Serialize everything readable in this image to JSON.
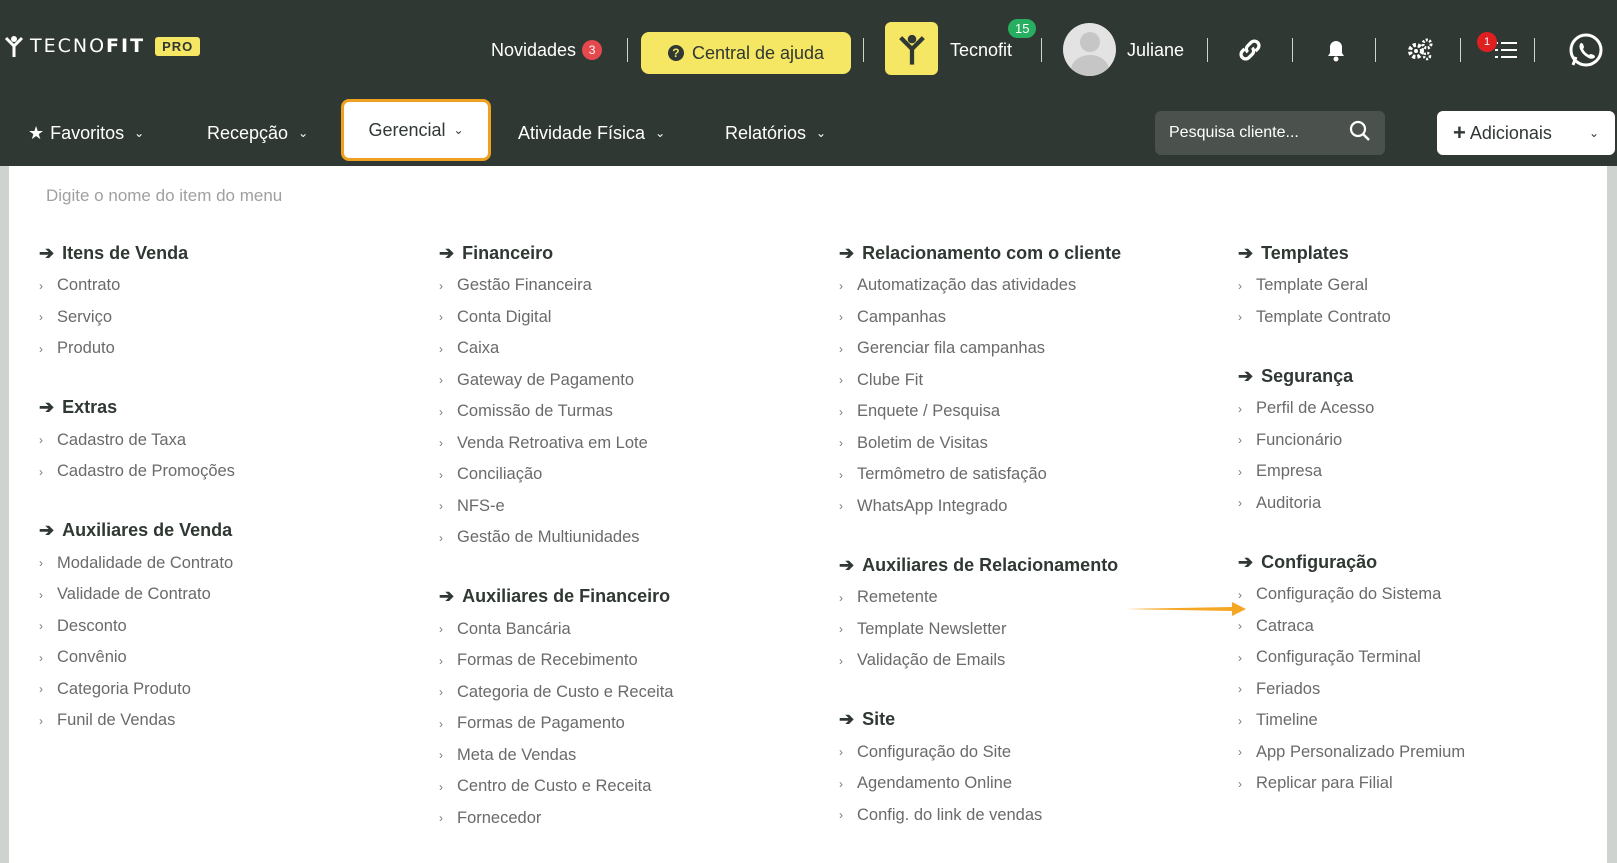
{
  "brand": {
    "name_light": "TECNO",
    "name_bold": "FIT",
    "pro_label": "PRO"
  },
  "top": {
    "news_label": "Novidades",
    "news_count": "3",
    "help_label": "Central de ajuda",
    "unit_badge": "15",
    "unit_name": "Tecnofit",
    "user_name": "Juliane",
    "tasks_badge": "1"
  },
  "nav": {
    "favoritos": "Favoritos",
    "recepcao": "Recepção",
    "gerencial": "Gerencial",
    "atividade": "Atividade Física",
    "relatorios": "Relatórios",
    "search_placeholder": "Pesquisa cliente...",
    "adicionais": "Adicionais"
  },
  "menu": {
    "filter_placeholder": "Digite o nome do item do menu",
    "col1": [
      {
        "title": "Itens de Venda",
        "items": [
          "Contrato",
          "Serviço",
          "Produto"
        ]
      },
      {
        "title": "Extras",
        "items": [
          "Cadastro de Taxa",
          "Cadastro de Promoções"
        ]
      },
      {
        "title": "Auxiliares de Venda",
        "items": [
          "Modalidade de Contrato",
          "Validade de Contrato",
          "Desconto",
          "Convênio",
          "Categoria Produto",
          "Funil de Vendas"
        ]
      }
    ],
    "col2": [
      {
        "title": "Financeiro",
        "items": [
          "Gestão Financeira",
          "Conta Digital",
          "Caixa",
          "Gateway de Pagamento",
          "Comissão de Turmas",
          "Venda Retroativa em Lote",
          "Conciliação",
          "NFS-e",
          "Gestão de Multiunidades"
        ]
      },
      {
        "title": "Auxiliares de Financeiro",
        "items": [
          "Conta Bancária",
          "Formas de Recebimento",
          "Categoria de Custo e Receita",
          "Formas de Pagamento",
          "Meta de Vendas",
          "Centro de Custo e Receita",
          "Fornecedor"
        ]
      }
    ],
    "col3": [
      {
        "title": "Relacionamento com o cliente",
        "items": [
          "Automatização das atividades",
          "Campanhas",
          "Gerenciar fila campanhas",
          "Clube Fit",
          "Enquete / Pesquisa",
          "Boletim de Visitas",
          "Termômetro de satisfação",
          "WhatsApp Integrado"
        ]
      },
      {
        "title": "Auxiliares de Relacionamento",
        "items": [
          "Remetente",
          "Template Newsletter",
          "Validação de Emails"
        ]
      },
      {
        "title": "Site",
        "items": [
          "Configuração do Site",
          "Agendamento Online",
          "Config. do link de vendas"
        ]
      }
    ],
    "col4": [
      {
        "title": "Templates",
        "items": [
          "Template Geral",
          "Template Contrato"
        ]
      },
      {
        "title": "Segurança",
        "items": [
          "Perfil de Acesso",
          "Funcionário",
          "Empresa",
          "Auditoria"
        ]
      },
      {
        "title": "Configuração",
        "items": [
          "Configuração do Sistema",
          "Catraca",
          "Configuração Terminal",
          "Feriados",
          "Timeline",
          "App Personalizado Premium",
          "Replicar para Filial"
        ]
      }
    ]
  },
  "colors": {
    "dark": "#303833",
    "accent_yellow": "#f5e663",
    "highlight_orange": "#f0a020"
  }
}
